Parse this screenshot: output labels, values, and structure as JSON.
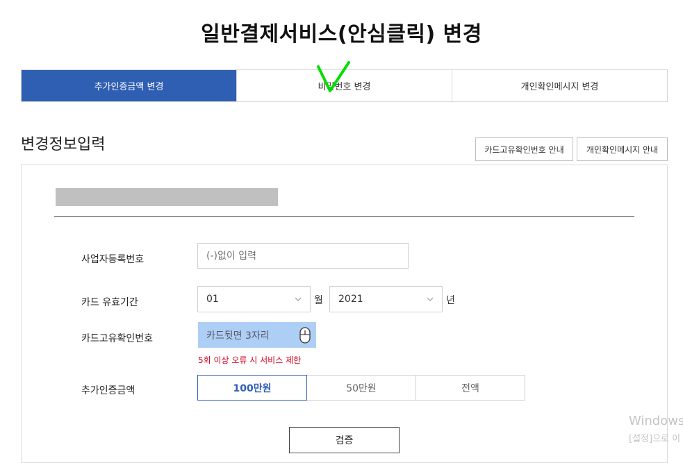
{
  "page": {
    "title": "일반결제서비스(안심클릭) 변경"
  },
  "tabs": [
    {
      "label": "추가인증금액 변경",
      "active": true
    },
    {
      "label": "비밀번호 변경",
      "active": false
    },
    {
      "label": "개인확인메시지 변경",
      "active": false
    }
  ],
  "section": {
    "title": "변경정보입력",
    "guide_buttons": [
      "카드고유확인번호 안내",
      "개인확인메시지 안내"
    ]
  },
  "form": {
    "business_number": {
      "label": "사업자등록번호",
      "placeholder": "(-)없이 입력",
      "value": ""
    },
    "expiry": {
      "label": "카드 유효기간",
      "month": "01",
      "month_unit": "월",
      "year": "2021",
      "year_unit": "년"
    },
    "card_code": {
      "label": "카드고유확인번호",
      "placeholder": "카드뒷면 3자리",
      "error": "5회 이상 오류 시 서비스 제한"
    },
    "amount": {
      "label": "추가인증금액",
      "options": [
        "100만원",
        "50만원",
        "전액"
      ],
      "selected": "100만원"
    },
    "verify_label": "검증"
  },
  "overlay": {
    "watermark_line1": "Windows",
    "watermark_line2": "[설정]으로 이"
  },
  "colors": {
    "accent": "#2f5fb3",
    "error": "#d0021b",
    "cvc_bg": "#aecff5",
    "annotation": "#00e000"
  }
}
